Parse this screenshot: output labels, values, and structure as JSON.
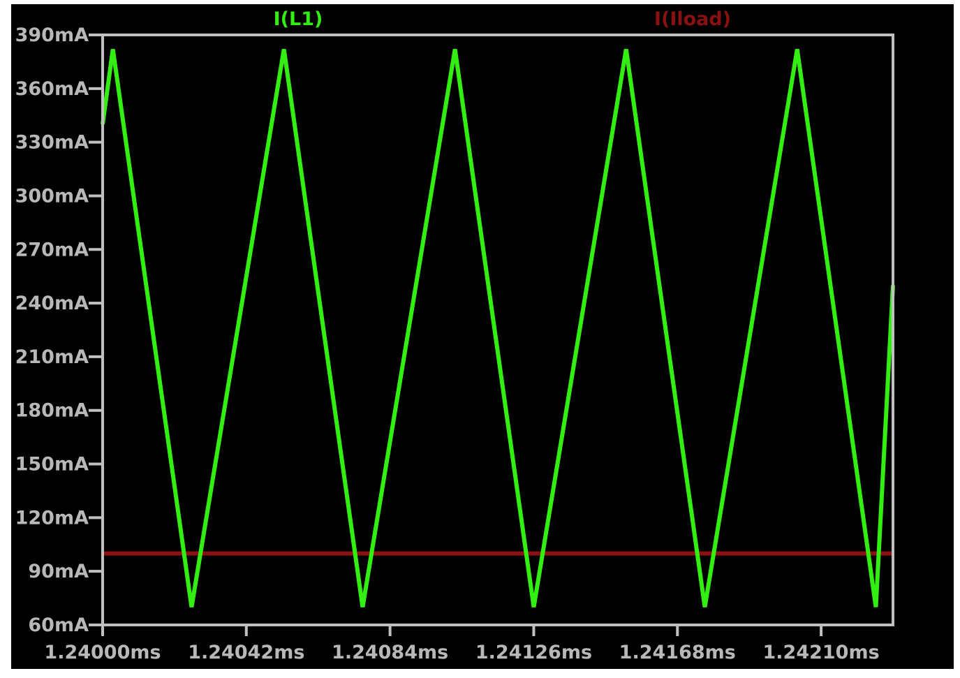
{
  "chart_data": {
    "type": "line",
    "title": "",
    "xlabel": "",
    "ylabel": "",
    "background_color": "#000000",
    "axis_color": "#c0c0c0",
    "grid": false,
    "legend_placement": "top",
    "xlim": [
      1.24,
      1.24231
    ],
    "ylim": [
      60,
      390
    ],
    "x_unit": "ms",
    "y_unit": "mA",
    "x_ticks": [
      1.24,
      1.24042,
      1.24084,
      1.24126,
      1.24168,
      1.2421
    ],
    "x_tick_labels": [
      "1.24000ms",
      "1.24042ms",
      "1.24084ms",
      "1.24126ms",
      "1.24168ms",
      "1.24210ms"
    ],
    "y_ticks": [
      390,
      360,
      330,
      300,
      270,
      240,
      210,
      180,
      150,
      120,
      90,
      60
    ],
    "y_tick_labels": [
      "390mA",
      "360mA",
      "330mA",
      "300mA",
      "270mA",
      "240mA",
      "210mA",
      "180mA",
      "150mA",
      "120mA",
      "90mA",
      "60mA"
    ],
    "series": [
      {
        "name": "I(L1)",
        "color": "#33ee11",
        "x": [
          1.24,
          1.24003,
          1.24026,
          1.24053,
          1.24076,
          1.24103,
          1.24126,
          1.24153,
          1.24176,
          1.24203,
          1.24226,
          1.24231
        ],
        "values": [
          340,
          382,
          70,
          382,
          70,
          382,
          70,
          382,
          70,
          382,
          70,
          250
        ]
      },
      {
        "name": "I(Iload)",
        "color": "#8a1111",
        "x": [
          1.24,
          1.24231
        ],
        "values": [
          100,
          100
        ]
      }
    ]
  }
}
